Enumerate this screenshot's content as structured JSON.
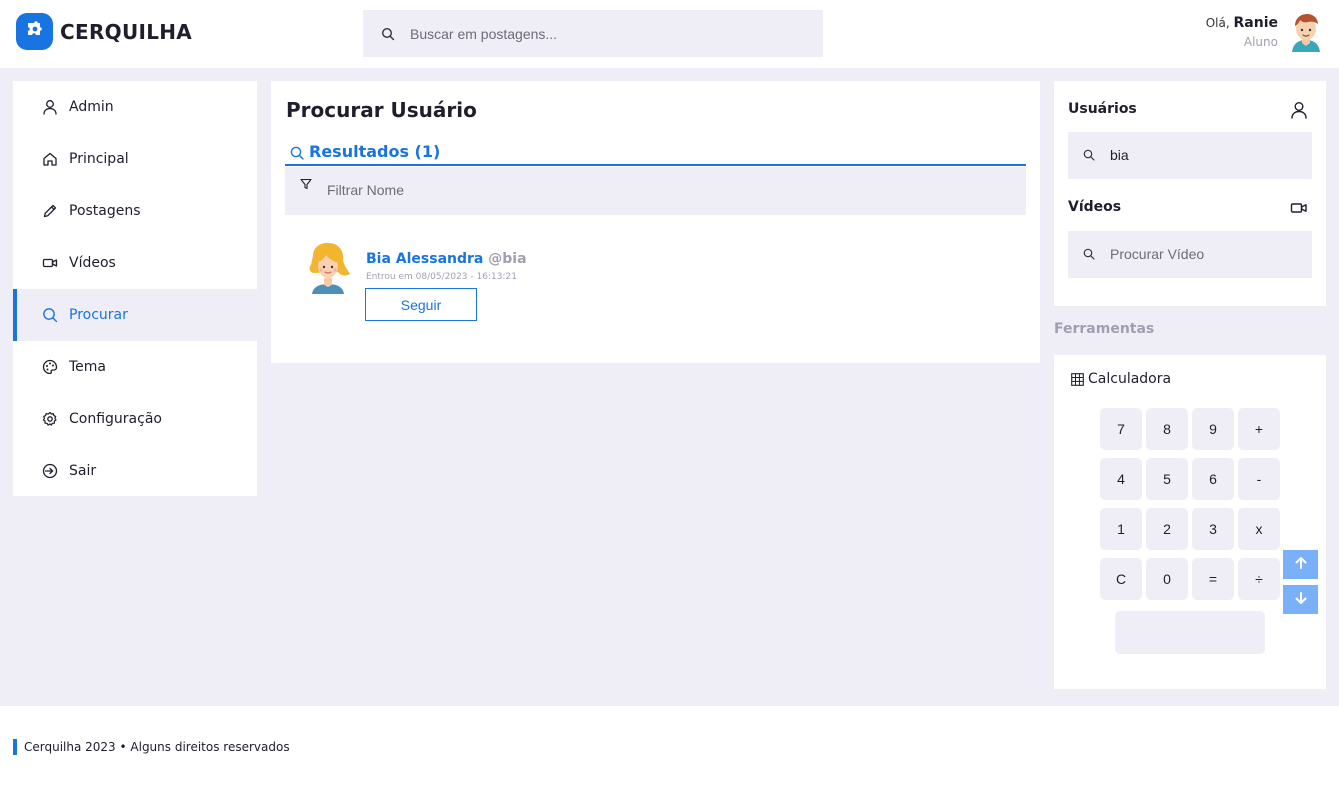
{
  "header": {
    "brand": "CERQUILHA",
    "search_placeholder": "Buscar em postagens...",
    "greeting": "Olá,",
    "user_name": "Ranie",
    "user_role": "Aluno"
  },
  "sidebar": {
    "items": [
      {
        "label": "Admin",
        "icon": "user-icon"
      },
      {
        "label": "Principal",
        "icon": "home-icon"
      },
      {
        "label": "Postagens",
        "icon": "pencil-icon"
      },
      {
        "label": "Vídeos",
        "icon": "video-icon"
      },
      {
        "label": "Procurar",
        "icon": "search-icon",
        "active": true
      },
      {
        "label": "Tema",
        "icon": "palette-icon"
      },
      {
        "label": "Configuração",
        "icon": "gear-icon"
      },
      {
        "label": "Sair",
        "icon": "logout-icon"
      }
    ]
  },
  "main": {
    "title": "Procurar Usuário",
    "results_label": "Resultados (1)",
    "filter_placeholder": "Filtrar Nome",
    "results": [
      {
        "name": "Bia Alessandra",
        "handle": "@bia",
        "joined": "Entrou em 08/05/2023 - 16:13:21",
        "follow_label": "Seguir"
      }
    ]
  },
  "right": {
    "users_title": "Usuários",
    "users_search_value": "bia",
    "videos_title": "Vídeos",
    "videos_search_placeholder": "Procurar Vídeo",
    "tools_title": "Ferramentas",
    "calculator_title": "Calculadora",
    "calculator_keys": [
      "7",
      "8",
      "9",
      "+",
      "4",
      "5",
      "6",
      "-",
      "1",
      "2",
      "3",
      "x",
      "C",
      "0",
      "=",
      "÷"
    ]
  },
  "footer": {
    "text": "Cerquilha 2023 • Alguns direitos reservados"
  },
  "colors": {
    "accent": "#1874e0",
    "background": "#efeef7",
    "muted": "#a09fb1",
    "scroll_button": "#7ab0f7"
  }
}
